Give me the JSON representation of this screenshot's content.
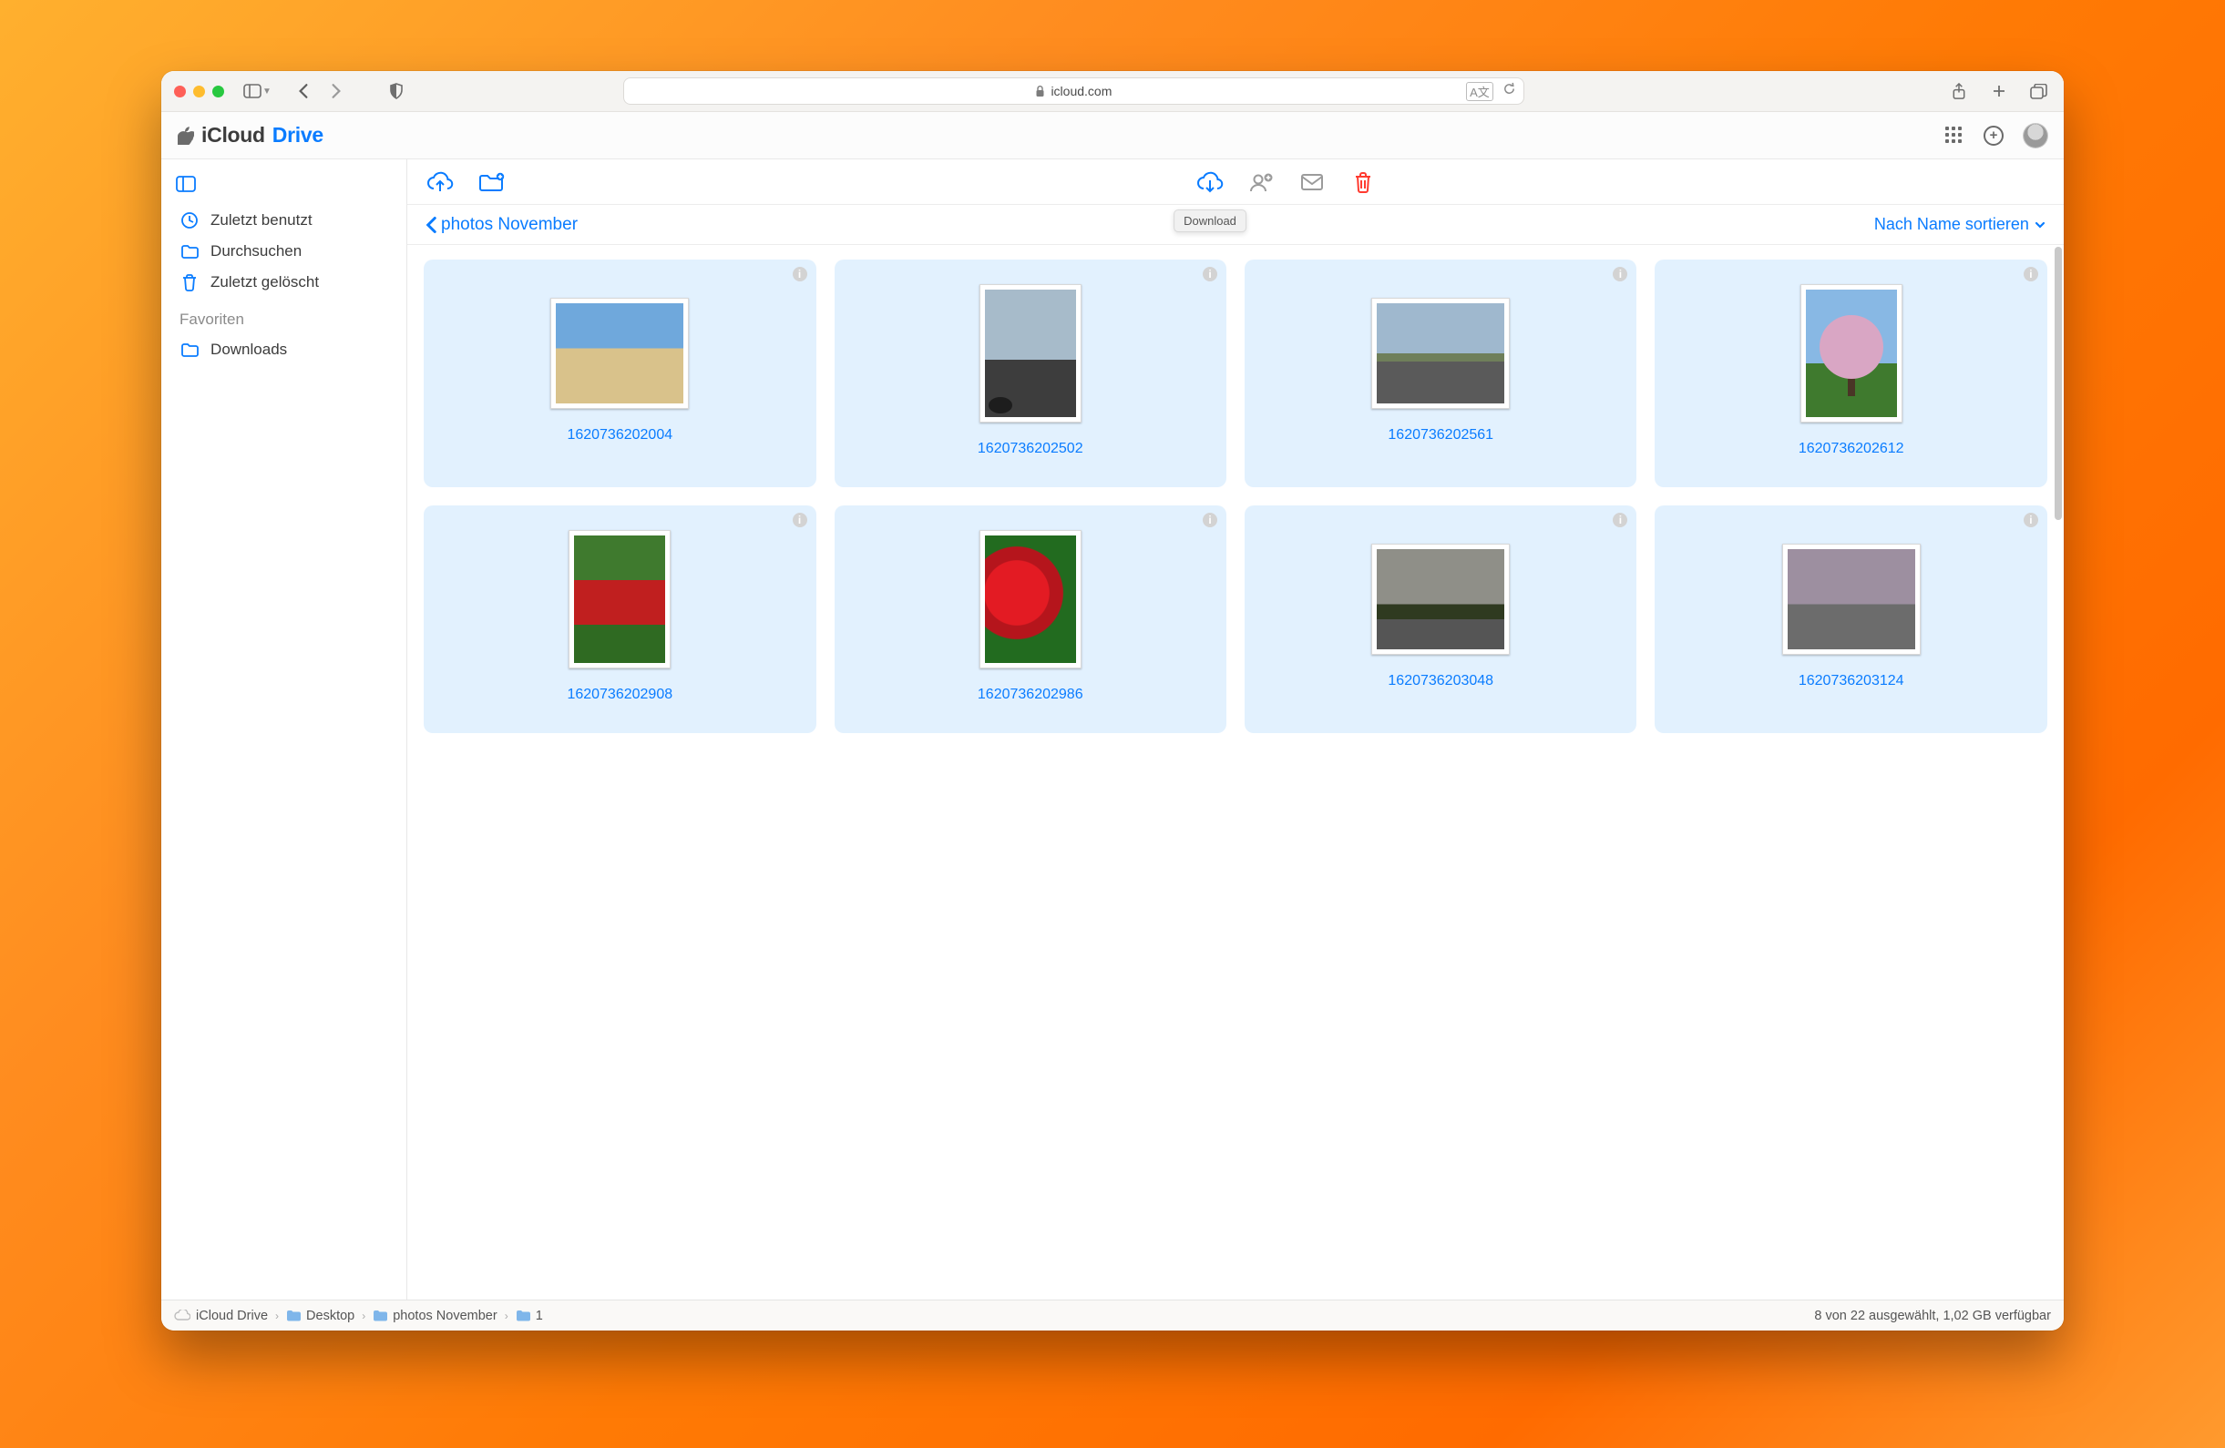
{
  "browser": {
    "domain": "icloud.com"
  },
  "brand": {
    "icloud": "iCloud",
    "drive": "Drive"
  },
  "header_icons": {
    "apps": "apps-grid-icon",
    "add": "add-circle-icon",
    "avatar": "account-avatar"
  },
  "sidebar": {
    "items": [
      {
        "icon": "clock-icon",
        "label": "Zuletzt benutzt"
      },
      {
        "icon": "folder-icon",
        "label": "Durchsuchen"
      },
      {
        "icon": "trash-icon",
        "label": "Zuletzt gelöscht"
      }
    ],
    "favorites_header": "Favoriten",
    "favorites": [
      {
        "icon": "folder-icon",
        "label": "Downloads"
      }
    ]
  },
  "toolbar": {
    "upload": "upload-cloud-icon",
    "new_folder": "new-folder-icon",
    "download": "download-cloud-icon",
    "download_tooltip": "Download",
    "share_people": "share-people-icon",
    "mail": "mail-icon",
    "trash": "trash-icon"
  },
  "breadcrumb": {
    "back_label": "photos November",
    "current": "1",
    "sort_label": "Nach Name sortieren"
  },
  "files": [
    {
      "name": "1620736202004",
      "thumb": "ph-beach",
      "orient": "land"
    },
    {
      "name": "1620736202502",
      "thumb": "ph-sky",
      "orient": "port"
    },
    {
      "name": "1620736202561",
      "thumb": "ph-road",
      "orient": "land"
    },
    {
      "name": "1620736202612",
      "thumb": "ph-tree",
      "orient": "port"
    },
    {
      "name": "1620736202908",
      "thumb": "ph-field",
      "orient": "port"
    },
    {
      "name": "1620736202986",
      "thumb": "ph-tulip",
      "orient": "port"
    },
    {
      "name": "1620736203048",
      "thumb": "ph-storm",
      "orient": "land"
    },
    {
      "name": "1620736203124",
      "thumb": "ph-hwy",
      "orient": "land"
    }
  ],
  "path": {
    "segments": [
      "iCloud Drive",
      "Desktop",
      "photos November",
      "1"
    ]
  },
  "status_bar": "8 von 22 ausgewählt, 1,02 GB verfügbar"
}
